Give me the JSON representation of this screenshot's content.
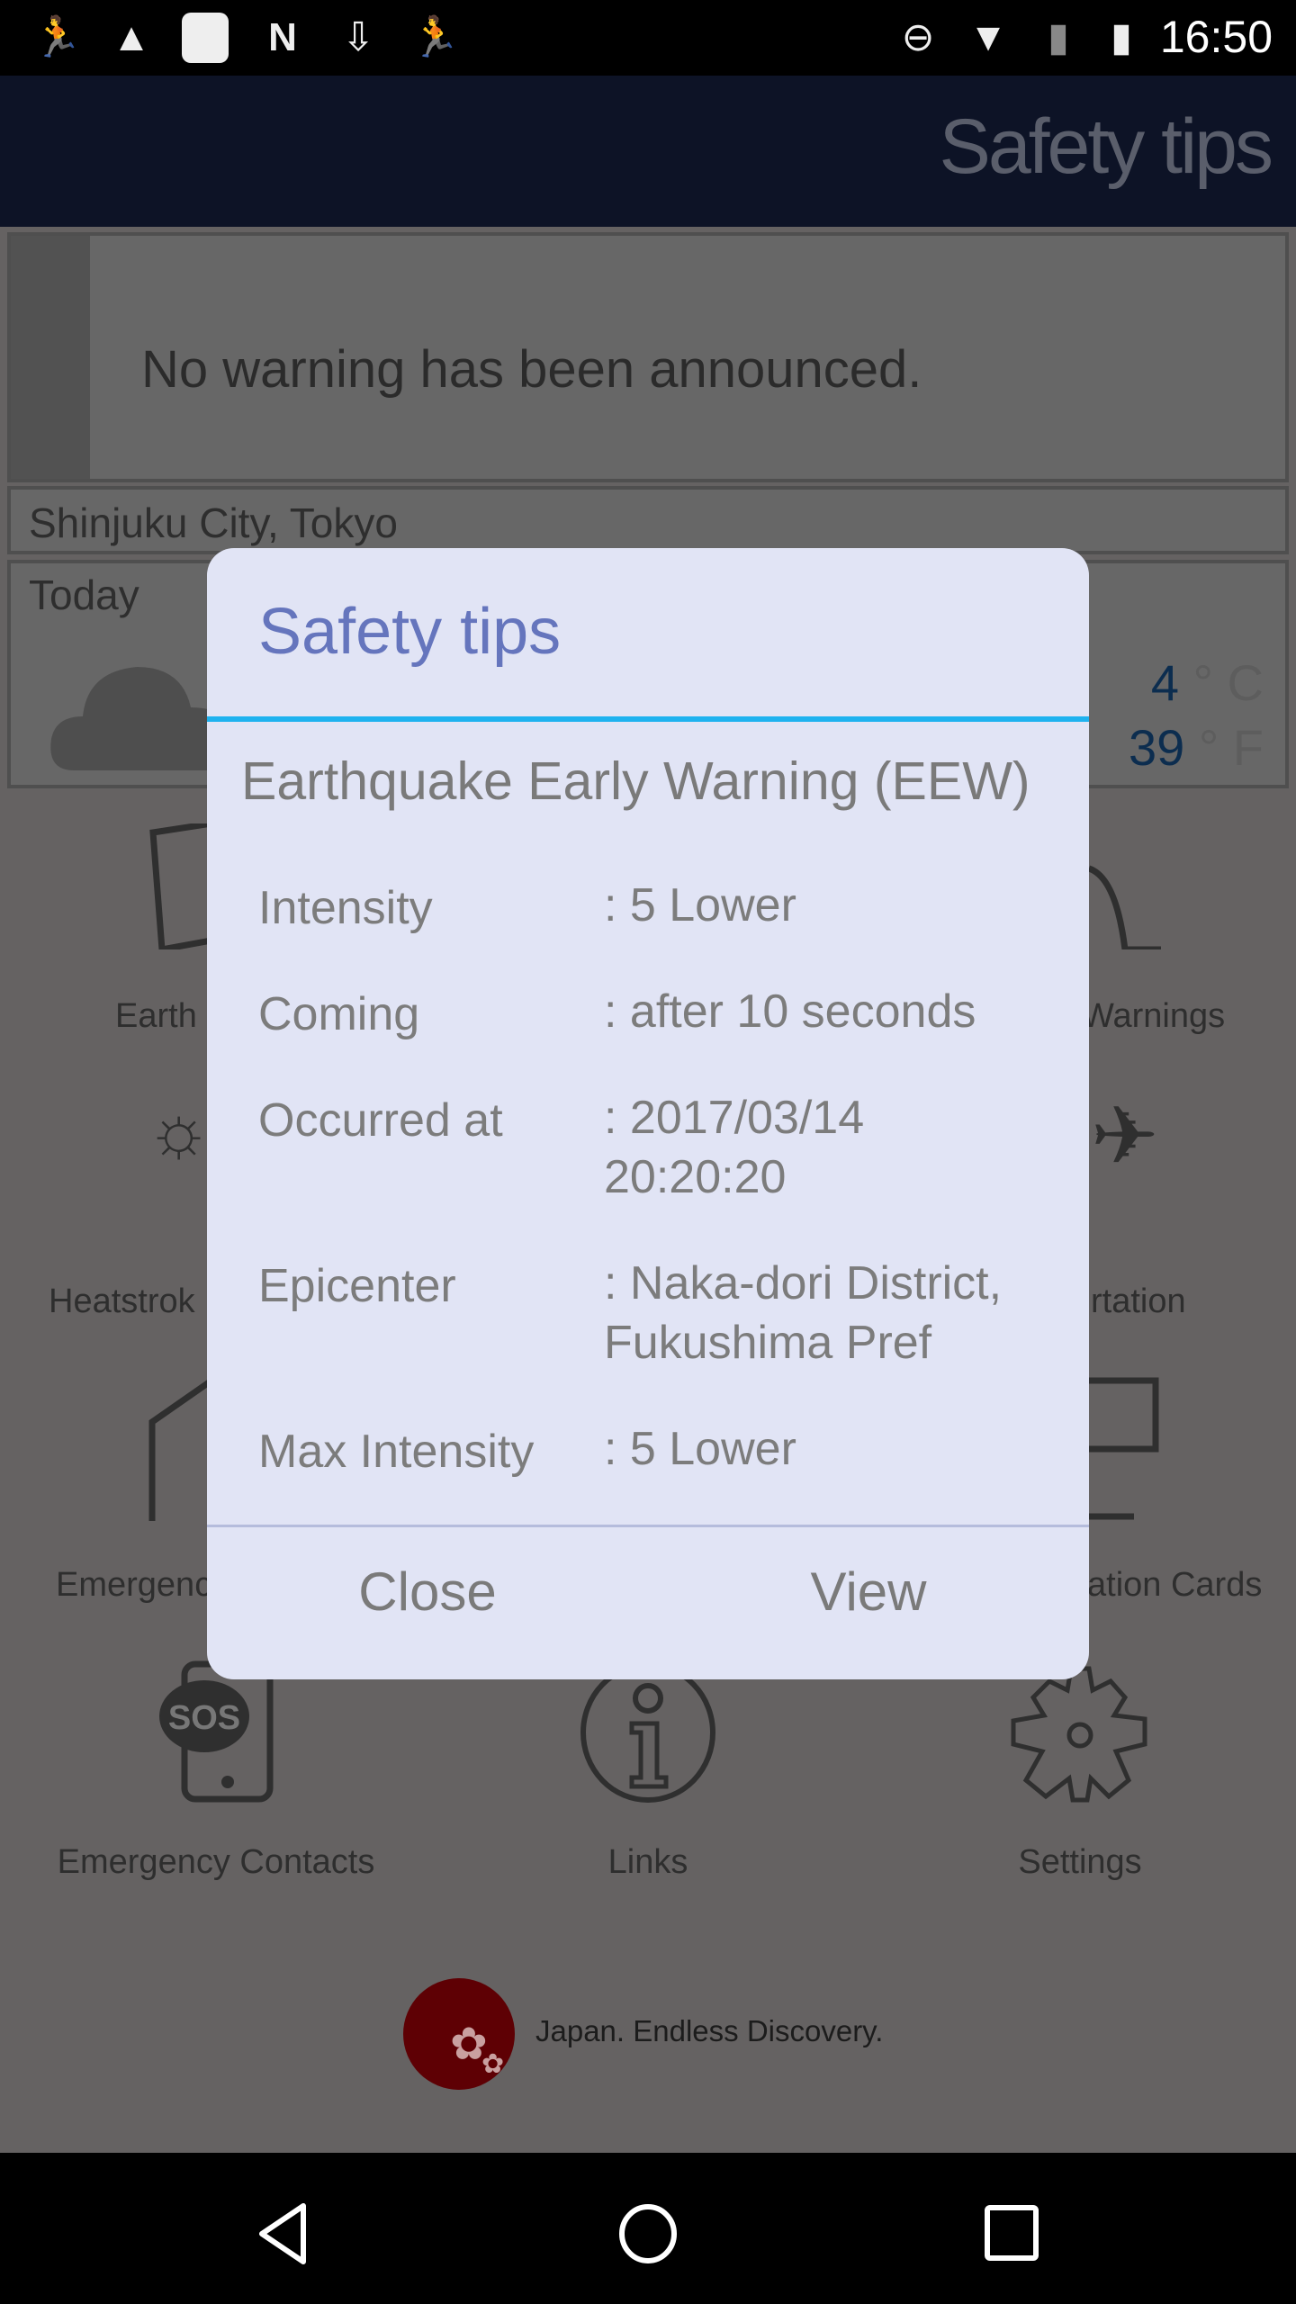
{
  "status_bar": {
    "time": "16:50",
    "left_icons": [
      "evacuation-icon",
      "image-icon",
      "blank-notification-icon",
      "n-icon",
      "download-icon",
      "evacuation-icon"
    ],
    "right_icons": [
      "do-not-disturb-icon",
      "wifi-icon",
      "no-sim-icon",
      "battery-charging-icon"
    ]
  },
  "app_bar": {
    "title": "Safety tips"
  },
  "warning": {
    "text": "No warning has been announced."
  },
  "location": {
    "text": "Shinjuku City, Tokyo"
  },
  "weather": {
    "day": "Today",
    "celsius": "4",
    "celsius_unit": "° C",
    "fahrenheit": "39",
    "fahrenheit_unit": "° F",
    "temp_color": "#0c2d4f"
  },
  "grid": {
    "row1_left": "Earth",
    "row1_right": "Warnings",
    "row2_left": "Heatstrok",
    "row2_right": "rtation",
    "row3_left": "Emergenc",
    "row3_right": "ation Cards",
    "row4": [
      "Emergency Contacts",
      "Links",
      "Settings"
    ]
  },
  "logo": {
    "text": "Japan. Endless Discovery."
  },
  "dialog": {
    "title": "Safety tips",
    "heading": "Earthquake Early Warning (EEW)",
    "rows": [
      {
        "label": "Intensity",
        "value": ": 5 Lower"
      },
      {
        "label": "Coming",
        "value": ": after 10 seconds"
      },
      {
        "label": "Occurred at",
        "value": ": 2017/03/14 20:20:20"
      },
      {
        "label": "Epicenter",
        "value": ": Naka-dori District, Fukushima Pref"
      },
      {
        "label": "Max Intensity",
        "value": ": 5 Lower"
      }
    ],
    "close_label": "Close",
    "view_label": "View",
    "accent_color": "#1eb2ef",
    "title_color": "#6575bd"
  },
  "nav_bar": {
    "icons": [
      "back-icon",
      "home-icon",
      "recents-icon"
    ]
  }
}
